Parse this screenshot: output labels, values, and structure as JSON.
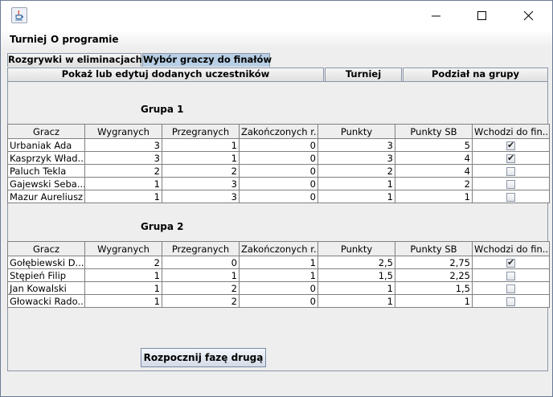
{
  "window": {
    "icon": "java-cup-icon",
    "controls": [
      "minimize-icon",
      "maximize-icon",
      "close-icon"
    ]
  },
  "menu": [
    "Turniej",
    "O programie"
  ],
  "tabs": {
    "outer": [
      "Rozgrywki w eliminacjach",
      "Wybór graczy do finałów"
    ],
    "inner": [
      "Pokaż lub edytuj dodanych uczestników",
      "Turniej",
      "Podział na grupy"
    ]
  },
  "groups": [
    {
      "title": "Grupa 1",
      "columns": [
        "Gracz",
        "Wygranych",
        "Przegranych",
        "Zakończonych r...",
        "Punkty",
        "Punkty SB",
        "Wchodzi do fin..."
      ],
      "rows": [
        {
          "name": "Urbaniak Ada",
          "won": "3",
          "lost": "1",
          "finished": "0",
          "points": "3",
          "sb": "5",
          "qualifies": true
        },
        {
          "name": "Kasprzyk Wład...",
          "won": "3",
          "lost": "1",
          "finished": "0",
          "points": "3",
          "sb": "4",
          "qualifies": true
        },
        {
          "name": "Paluch Tekla",
          "won": "2",
          "lost": "2",
          "finished": "0",
          "points": "2",
          "sb": "4",
          "qualifies": false
        },
        {
          "name": "Gajewski Seba...",
          "won": "1",
          "lost": "3",
          "finished": "0",
          "points": "1",
          "sb": "2",
          "qualifies": false
        },
        {
          "name": "Mazur Aureliusz",
          "won": "1",
          "lost": "3",
          "finished": "0",
          "points": "1",
          "sb": "1",
          "qualifies": false
        }
      ]
    },
    {
      "title": "Grupa 2",
      "columns": [
        "Gracz",
        "Wygranych",
        "Przegranych",
        "Zakończonych r...",
        "Punkty",
        "Punkty SB",
        "Wchodzi do fin..."
      ],
      "rows": [
        {
          "name": "Gołębiewski D...",
          "won": "2",
          "lost": "0",
          "finished": "1",
          "points": "2,5",
          "sb": "2,75",
          "qualifies": true
        },
        {
          "name": "Stępień Filip",
          "won": "1",
          "lost": "1",
          "finished": "1",
          "points": "1,5",
          "sb": "2,25",
          "qualifies": false
        },
        {
          "name": "Jan Kowalski",
          "won": "1",
          "lost": "2",
          "finished": "0",
          "points": "1",
          "sb": "1,5",
          "qualifies": false
        },
        {
          "name": "Głowacki Rado...",
          "won": "1",
          "lost": "2",
          "finished": "0",
          "points": "1",
          "sb": "1",
          "qualifies": false
        }
      ]
    }
  ],
  "start_button": "Rozpocznij fazę drugą"
}
